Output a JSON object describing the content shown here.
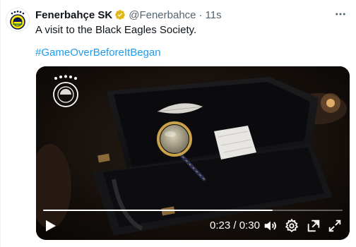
{
  "tweet": {
    "author_name": "Fenerbahçe SK",
    "handle": "@Fenerbahce",
    "separator": "·",
    "time": "11s",
    "text": "A visit to the Black Eagles Society.",
    "hashtag": "#GameOverBeforeItBegan"
  },
  "icons": {
    "verified": "verified-badge-icon",
    "more": "more-options-icon",
    "play": "play-icon",
    "volume": "volume-icon",
    "settings": "settings-gear-icon",
    "pip": "picture-in-picture-icon",
    "fullscreen": "fullscreen-icon"
  },
  "video": {
    "current_time": "0:23",
    "duration": "0:30",
    "time_separator": "/",
    "progress": 0.767
  },
  "colors": {
    "text_primary": "#0f1419",
    "text_secondary": "#536471",
    "link": "#1d9bf0",
    "verified_gold": "#e2b719",
    "fenerbahce_navy": "#0d1a4b",
    "fenerbahce_yellow": "#ffed00"
  }
}
